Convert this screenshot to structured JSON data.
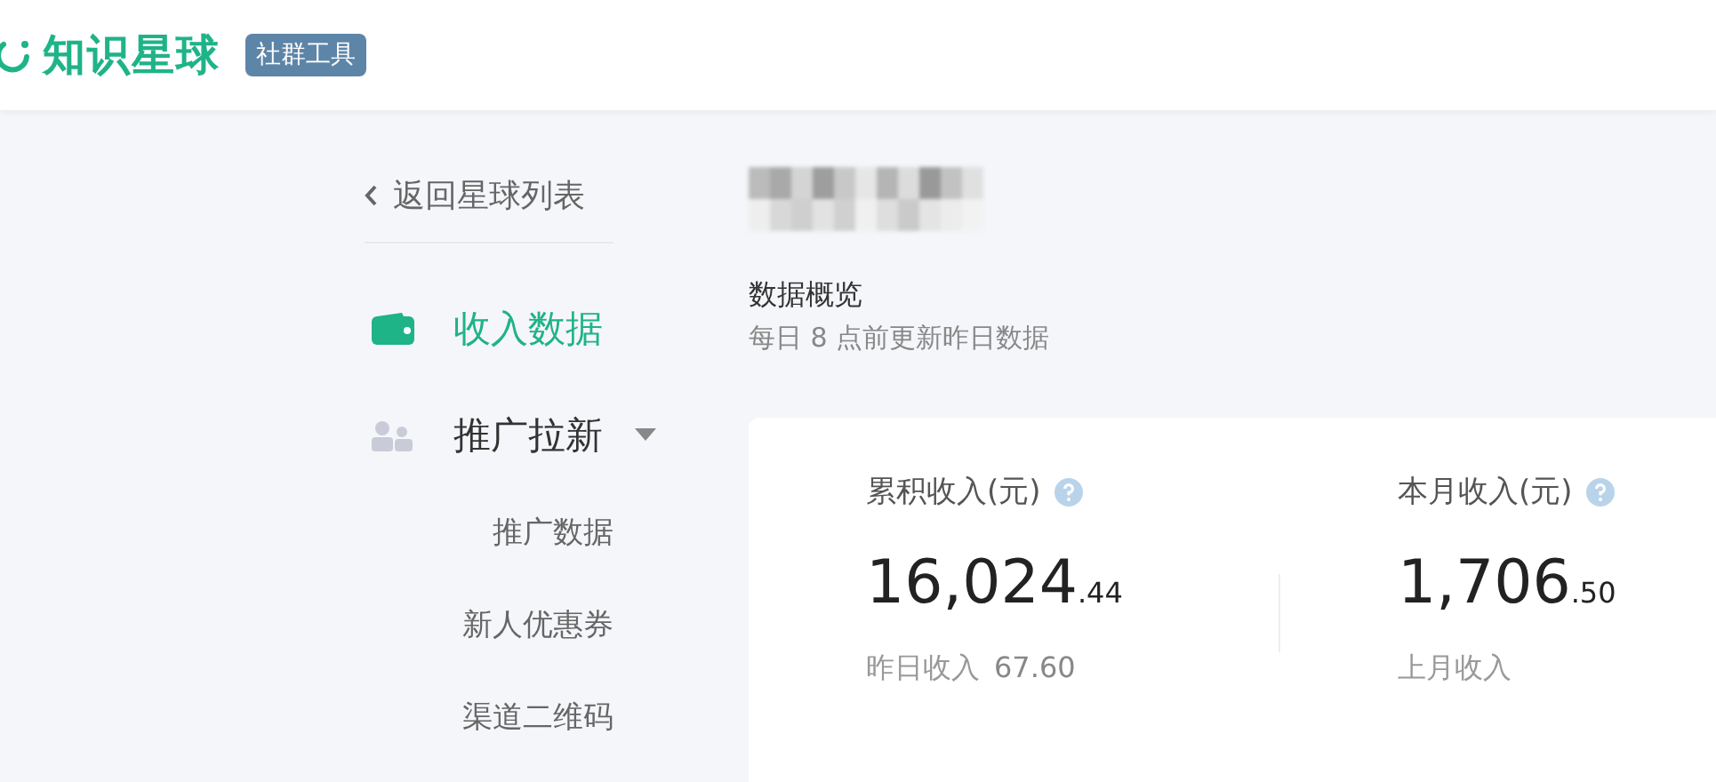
{
  "header": {
    "logo_text": "知识星球",
    "badge": "社群工具"
  },
  "sidebar": {
    "back_link": "返回星球列表",
    "items": [
      {
        "kind": "wallet",
        "label": "收入数据",
        "selected": true
      },
      {
        "kind": "people",
        "label": "推广拉新",
        "selected": false,
        "expanded": true,
        "children": [
          {
            "label": "推广数据"
          },
          {
            "label": "新人优惠券"
          },
          {
            "label": "渠道二维码"
          }
        ]
      }
    ]
  },
  "main": {
    "section_title": "数据概览",
    "section_note": "每日 8 点前更新昨日数据",
    "stats": [
      {
        "label": "累积收入(元)",
        "integer": "16,024",
        "fraction": ".44",
        "footer_label": "昨日收入",
        "footer_value": "67.60"
      },
      {
        "label": "本月收入(元)",
        "integer": "1,706",
        "fraction": ".50",
        "footer_label": "上月收入"
      }
    ]
  }
}
